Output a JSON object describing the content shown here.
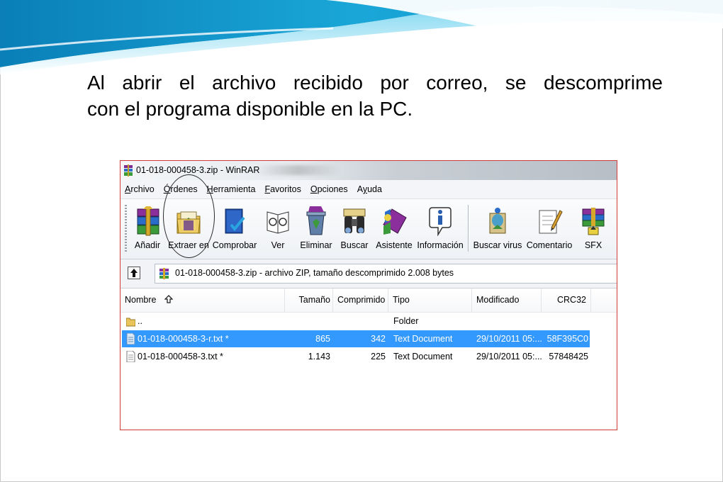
{
  "slide": {
    "caption_line1": "Al abrir el archivo recibido por correo, se descomprime",
    "caption_line2": "con el programa disponible en la PC."
  },
  "window": {
    "title": "01-018-000458-3.zip - WinRAR",
    "menu": [
      {
        "label": "Archivo",
        "accel": "A"
      },
      {
        "label": "Órdenes",
        "accel": "Ó"
      },
      {
        "label": "Herramienta",
        "accel": "H"
      },
      {
        "label": "Favoritos",
        "accel": "F"
      },
      {
        "label": "Opciones",
        "accel": "O"
      },
      {
        "label": "Ayuda",
        "accel": "y"
      }
    ],
    "toolbar": [
      {
        "label": "Añadir",
        "icon": "add-books-icon"
      },
      {
        "label": "Extraer en",
        "icon": "extract-folder-icon"
      },
      {
        "label": "Comprobar",
        "icon": "test-book-icon"
      },
      {
        "label": "Ver",
        "icon": "view-glasses-icon"
      },
      {
        "label": "Eliminar",
        "icon": "delete-recycle-icon"
      },
      {
        "label": "Buscar",
        "icon": "binoculars-icon"
      },
      {
        "label": "Asistente",
        "icon": "wizard-icon"
      },
      {
        "label": "Información",
        "icon": "info-icon"
      },
      {
        "label": "Buscar virus",
        "icon": "virus-scan-icon"
      },
      {
        "label": "Comentario",
        "icon": "comment-icon"
      },
      {
        "label": "SFX",
        "icon": "sfx-icon"
      }
    ],
    "address": "01-018-000458-3.zip - archivo ZIP, tamaño descomprimido 2.008 bytes",
    "columns": {
      "name": "Nombre",
      "size": "Tamaño",
      "packed": "Comprimido",
      "type": "Tipo",
      "modified": "Modificado",
      "crc": "CRC32"
    },
    "rows": [
      {
        "name": "..",
        "size": "",
        "packed": "",
        "type": "Folder",
        "modified": "",
        "crc": "",
        "icon": "folder-icon"
      },
      {
        "name": "01-018-000458-3-r.txt *",
        "size": "865",
        "packed": "342",
        "type": "Text Document",
        "modified": "29/10/2011 05:...",
        "crc": "58F395C0",
        "icon": "text-file-icon",
        "selected": true
      },
      {
        "name": "01-018-000458-3.txt *",
        "size": "1.143",
        "packed": "225",
        "type": "Text Document",
        "modified": "29/10/2011 05:...",
        "crc": "57848425",
        "icon": "text-file-icon"
      }
    ]
  }
}
